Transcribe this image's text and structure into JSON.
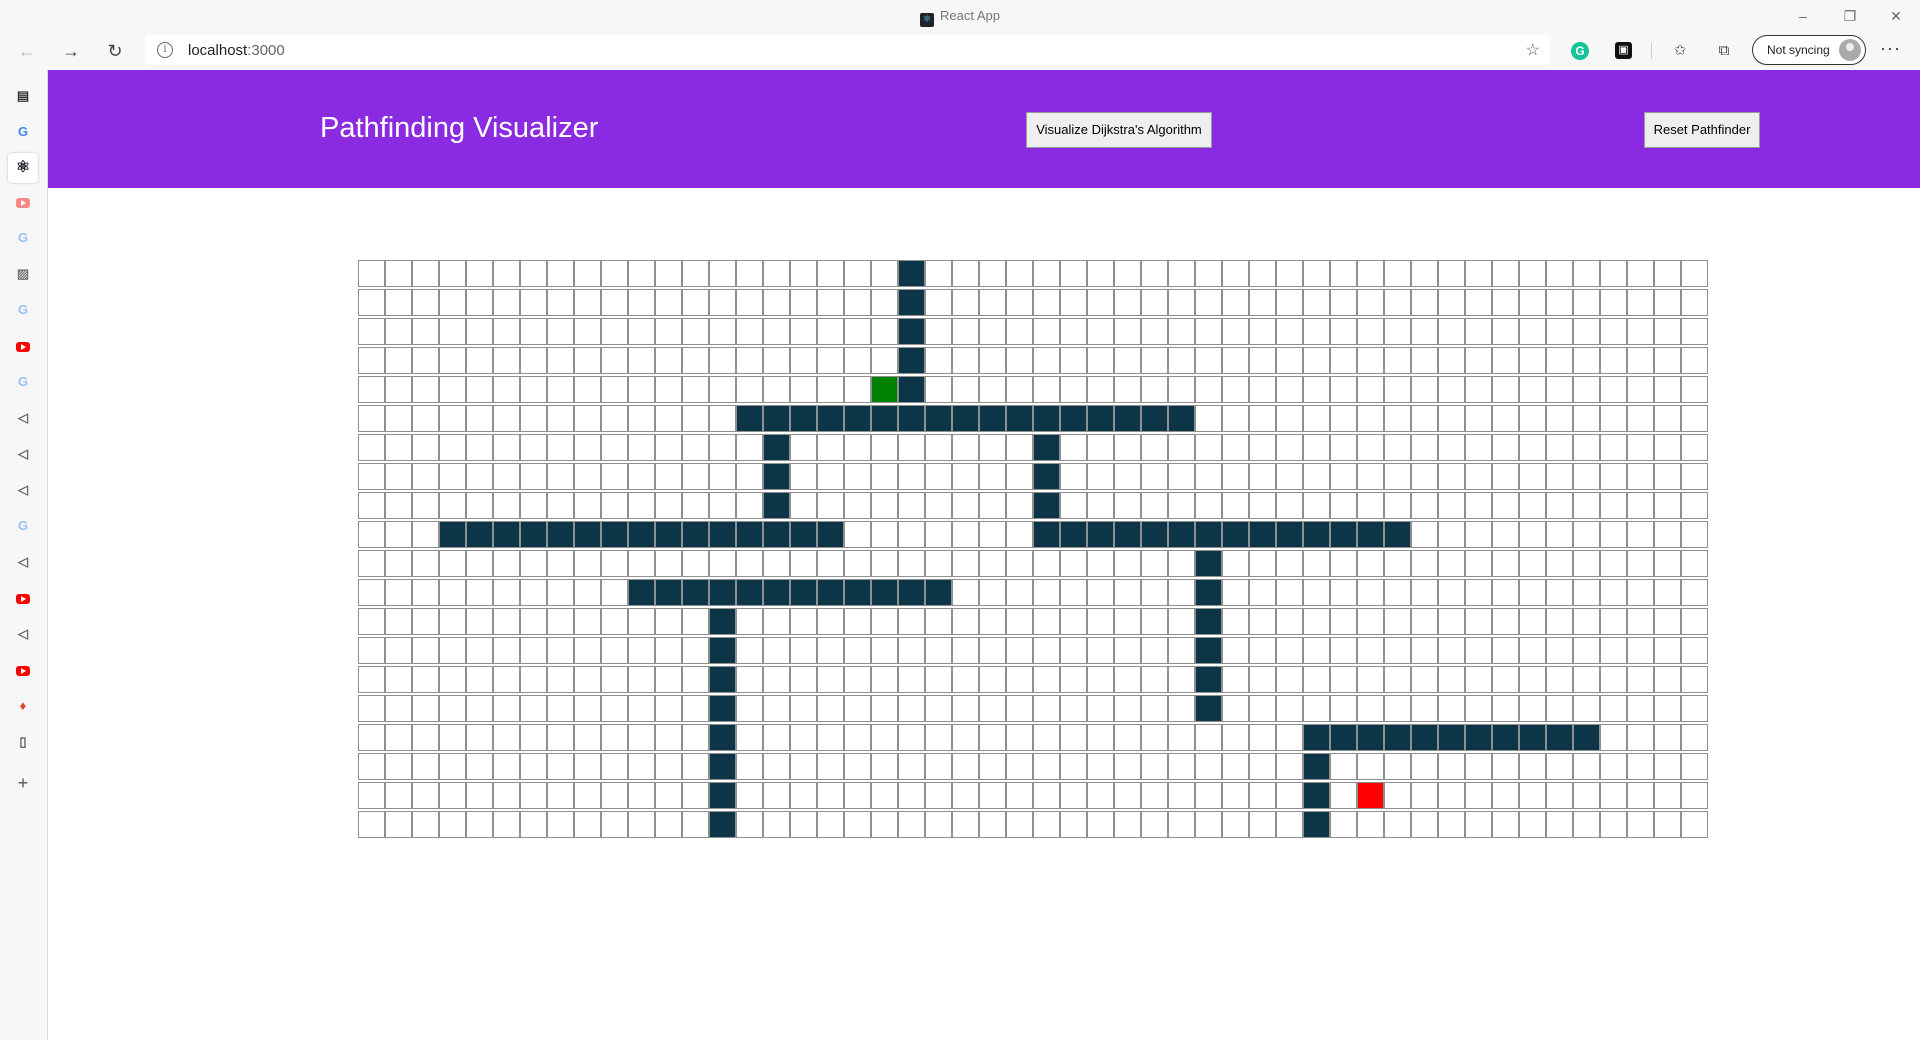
{
  "window": {
    "title": "React App",
    "minimize": "–",
    "maximize": "❐",
    "close": "✕"
  },
  "browser": {
    "url_host": "localhost",
    "url_port": ":3000",
    "sync_label": "Not syncing",
    "more_label": "···"
  },
  "header": {
    "title": "Pathfinding Visualizer",
    "visualize_button": "Visualize Dijkstra's Algorithm",
    "reset_button": "Reset Pathfinder"
  },
  "sidebar": {
    "icons": [
      "tab-actions-icon",
      "google-icon",
      "react-icon",
      "youtube-icon",
      "google-icon",
      "image-icon",
      "google-icon",
      "youtube-icon",
      "google-icon",
      "send-icon",
      "send-icon",
      "send-icon",
      "google-icon",
      "send-icon",
      "youtube-icon",
      "send-icon",
      "youtube-icon",
      "gitlab-icon",
      "file-icon",
      "add-icon"
    ]
  },
  "grid": {
    "rows": 20,
    "cols": 50,
    "start": [
      4,
      19
    ],
    "finish": [
      18,
      37
    ],
    "walls": [
      [
        0,
        20
      ],
      [
        1,
        20
      ],
      [
        2,
        20
      ],
      [
        3,
        20
      ],
      [
        4,
        20
      ],
      [
        5,
        14
      ],
      [
        5,
        15
      ],
      [
        5,
        16
      ],
      [
        5,
        17
      ],
      [
        5,
        18
      ],
      [
        5,
        19
      ],
      [
        5,
        20
      ],
      [
        5,
        21
      ],
      [
        5,
        22
      ],
      [
        5,
        23
      ],
      [
        5,
        24
      ],
      [
        5,
        25
      ],
      [
        5,
        26
      ],
      [
        5,
        27
      ],
      [
        5,
        28
      ],
      [
        5,
        29
      ],
      [
        5,
        30
      ],
      [
        6,
        15
      ],
      [
        7,
        15
      ],
      [
        8,
        15
      ],
      [
        6,
        25
      ],
      [
        7,
        25
      ],
      [
        8,
        25
      ],
      [
        9,
        3
      ],
      [
        9,
        4
      ],
      [
        9,
        5
      ],
      [
        9,
        6
      ],
      [
        9,
        7
      ],
      [
        9,
        8
      ],
      [
        9,
        9
      ],
      [
        9,
        10
      ],
      [
        9,
        11
      ],
      [
        9,
        12
      ],
      [
        9,
        13
      ],
      [
        9,
        14
      ],
      [
        9,
        15
      ],
      [
        9,
        16
      ],
      [
        9,
        17
      ],
      [
        9,
        25
      ],
      [
        9,
        26
      ],
      [
        9,
        27
      ],
      [
        9,
        28
      ],
      [
        9,
        29
      ],
      [
        9,
        30
      ],
      [
        9,
        31
      ],
      [
        9,
        32
      ],
      [
        9,
        33
      ],
      [
        9,
        34
      ],
      [
        9,
        35
      ],
      [
        9,
        36
      ],
      [
        9,
        37
      ],
      [
        9,
        38
      ],
      [
        10,
        31
      ],
      [
        11,
        31
      ],
      [
        12,
        31
      ],
      [
        13,
        31
      ],
      [
        14,
        31
      ],
      [
        15,
        31
      ],
      [
        11,
        10
      ],
      [
        11,
        11
      ],
      [
        11,
        12
      ],
      [
        11,
        13
      ],
      [
        11,
        14
      ],
      [
        11,
        15
      ],
      [
        11,
        16
      ],
      [
        11,
        17
      ],
      [
        11,
        18
      ],
      [
        11,
        19
      ],
      [
        11,
        20
      ],
      [
        11,
        21
      ],
      [
        12,
        13
      ],
      [
        13,
        13
      ],
      [
        14,
        13
      ],
      [
        15,
        13
      ],
      [
        16,
        13
      ],
      [
        17,
        13
      ],
      [
        18,
        13
      ],
      [
        19,
        13
      ],
      [
        16,
        35
      ],
      [
        16,
        36
      ],
      [
        16,
        37
      ],
      [
        16,
        38
      ],
      [
        16,
        39
      ],
      [
        16,
        40
      ],
      [
        16,
        41
      ],
      [
        16,
        42
      ],
      [
        16,
        43
      ],
      [
        16,
        44
      ],
      [
        16,
        45
      ],
      [
        17,
        35
      ],
      [
        18,
        35
      ],
      [
        19,
        35
      ]
    ]
  }
}
